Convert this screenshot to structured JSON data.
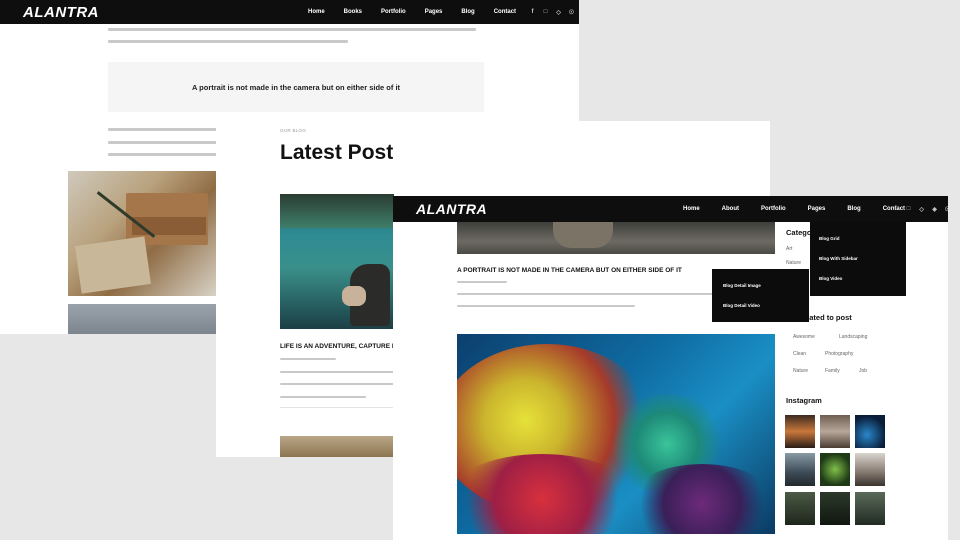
{
  "brand": "ALANTRA",
  "layer1": {
    "menu": [
      "Home",
      "Books",
      "Portfolio",
      "Pages",
      "Blog",
      "Contact"
    ],
    "social": [
      "f",
      "□",
      "◇",
      "☉"
    ],
    "quote": "A portrait is not made in the camera but on either side of it"
  },
  "layer2": {
    "kicker": "OUR BLOG",
    "heading": "Latest Post",
    "post_title": "LIFE IS AN ADVENTURE, CAPTURE EV"
  },
  "layer3": {
    "menu": [
      "Home",
      "About",
      "Portfolio",
      "Pages",
      "Blog",
      "Contact"
    ],
    "social": [
      "f",
      "□",
      "◇",
      "◈",
      "☉"
    ],
    "blog_dropdown": [
      "Blog Grid",
      "Blog With Sidebar",
      "Blog Video"
    ],
    "pages_dropdown": [
      "Blog Detail Image",
      "Blog Detail Video"
    ],
    "post_title": "A PORTRAIT IS NOT MADE IN THE CAMERA BUT ON EITHER SIDE OF IT",
    "sidebar": {
      "categories_heading": "Catego",
      "categories": [
        "Art",
        "Nature"
      ],
      "related_heading": "elated to post",
      "tags": [
        "Awesome",
        "Landscaping",
        "Clean",
        "Photography",
        "Nature",
        "Family",
        "Job"
      ],
      "instagram_heading": "Instagram"
    }
  }
}
